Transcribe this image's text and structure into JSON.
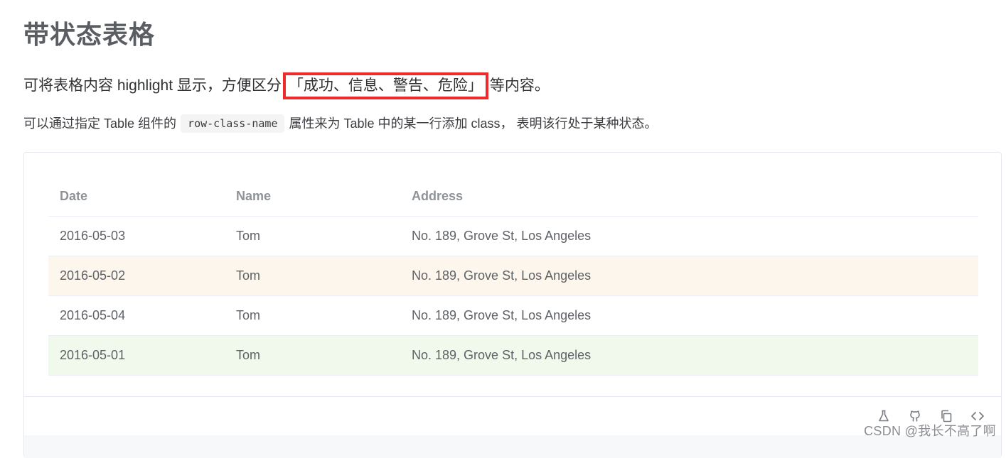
{
  "page": {
    "title": "带状态表格",
    "intro_before": "可将表格内容 highlight 显示，方便区分",
    "intro_highlight": "「成功、信息、警告、危险」",
    "intro_after": "等内容。",
    "desc_before": "可以通过指定 Table 组件的",
    "desc_code": "row-class-name",
    "desc_after": "属性来为 Table 中的某一行添加 class， 表明该行处于某种状态。"
  },
  "table": {
    "headers": {
      "date": "Date",
      "name": "Name",
      "address": "Address"
    },
    "rows": [
      {
        "date": "2016-05-03",
        "name": "Tom",
        "address": "No. 189, Grove St, Los Angeles",
        "status": "normal"
      },
      {
        "date": "2016-05-02",
        "name": "Tom",
        "address": "No. 189, Grove St, Los Angeles",
        "status": "warning"
      },
      {
        "date": "2016-05-04",
        "name": "Tom",
        "address": "No. 189, Grove St, Los Angeles",
        "status": "normal"
      },
      {
        "date": "2016-05-01",
        "name": "Tom",
        "address": "No. 189, Grove St, Los Angeles",
        "status": "success"
      }
    ]
  },
  "toolbar": {
    "icons": [
      "flask-icon",
      "github-icon",
      "copy-icon",
      "code-icon"
    ]
  },
  "watermark": "CSDN @我长不高了啊",
  "colors": {
    "warning_row": "#fdf6ec",
    "success_row": "#f0f9eb",
    "highlight_border": "#ee2b2b"
  }
}
